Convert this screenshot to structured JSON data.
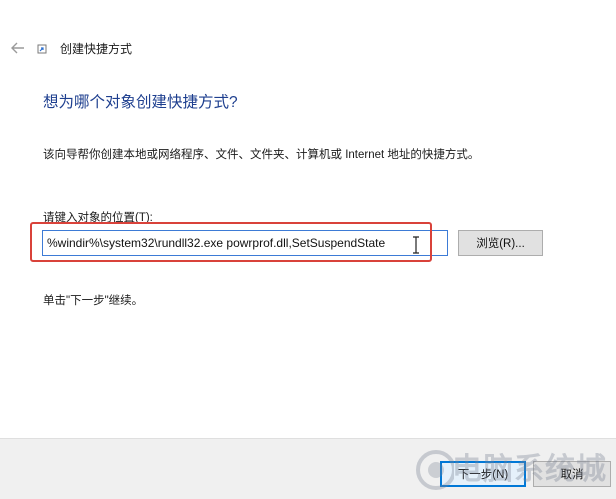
{
  "window": {
    "title": "创建快捷方式"
  },
  "icons": {
    "back": "back-arrow-icon",
    "wizard": "shortcut-wizard-icon",
    "text_cursor": "text-cursor-icon",
    "watermark_logo": "watermark-logo"
  },
  "page": {
    "heading": "想为哪个对象创建快捷方式?",
    "description": "该向导帮你创建本地或网络程序、文件、文件夹、计算机或 Internet 地址的快捷方式。",
    "location_label": "请键入对象的位置(T):",
    "location_value": "%windir%\\system32\\rundll32.exe powrprof.dll,SetSuspendState",
    "browse_label": "浏览(R)...",
    "instruction": "单击\"下一步\"继续。"
  },
  "footer": {
    "next_label": "下一步(N)",
    "cancel_label": "取消"
  },
  "watermark": {
    "text": "电脑系统城"
  },
  "colors": {
    "heading": "#1e3f8f",
    "highlight_box": "#d9423a",
    "input_border": "#3d7bd6",
    "default_button_border": "#0078d7",
    "footer_background": "#f0f0f0"
  }
}
